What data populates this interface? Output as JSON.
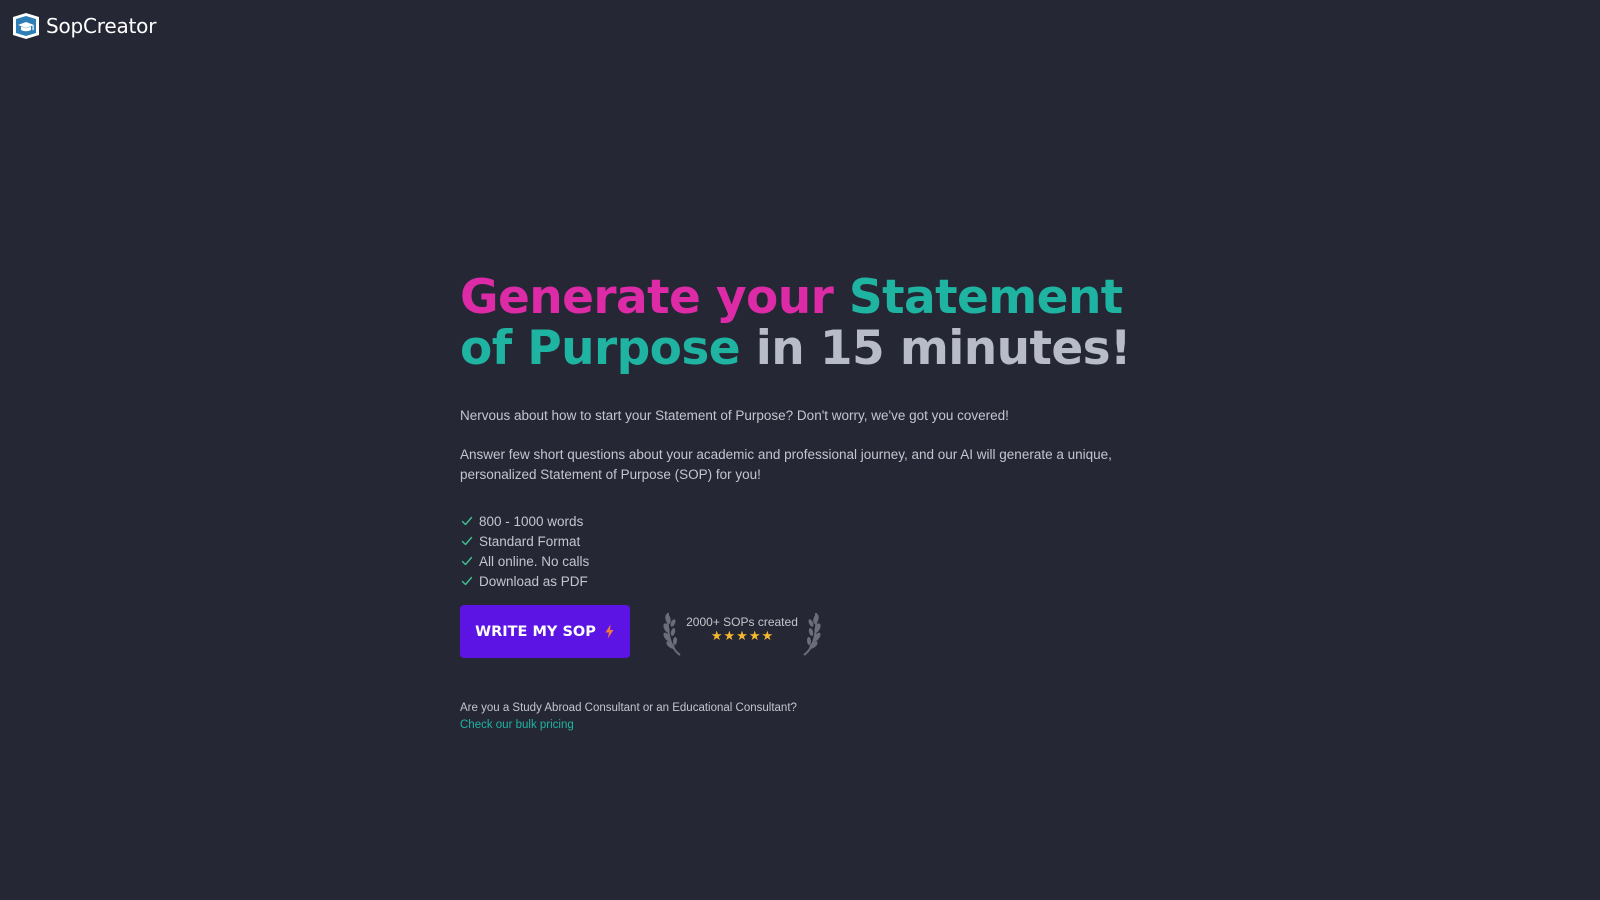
{
  "brand": {
    "name": "SopCreator",
    "icon": "graduation-cap-logo-icon"
  },
  "hero": {
    "headline": {
      "part1": "Generate your ",
      "part2": "Statement of Purpose",
      "part3": " in 15 minutes!"
    },
    "paragraph1": "Nervous about how to start your Statement of Purpose? Don't worry, we've got you covered!",
    "paragraph2": "Answer few short questions about your academic and professional journey, and our AI will generate a unique, personalized Statement of Purpose (SOP) for you!",
    "features": [
      "800 - 1000 words",
      "Standard Format",
      "All online. No calls",
      "Download as PDF"
    ],
    "cta_label": "WRITE MY SOP",
    "badge": {
      "text": "2000+ SOPs created",
      "stars": 5
    },
    "consultant_question": "Are you a Study Abroad Consultant or an Educational Consultant?",
    "bulk_link": "Check our bulk pricing"
  },
  "colors": {
    "background": "#252834",
    "accent_pink": "#dd2aa6",
    "accent_teal": "#1fb3a2",
    "button": "#5b14e3",
    "star": "#f5b82e",
    "check": "#3fc08e",
    "bolt": "#f07a3a"
  }
}
